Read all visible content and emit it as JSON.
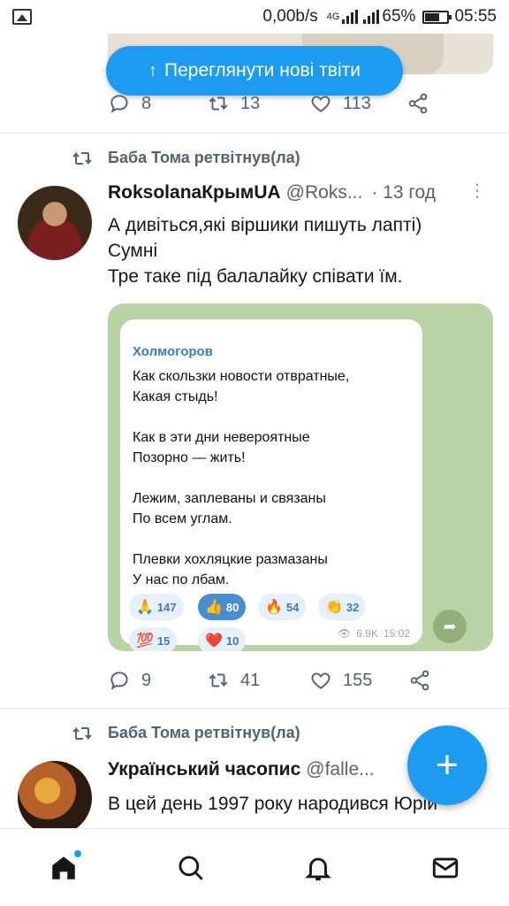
{
  "status_bar": {
    "speed": "0,00b/s",
    "network": "4G",
    "battery": "65%",
    "time": "05:55"
  },
  "banner": {
    "label": "Переглянути нові твіти"
  },
  "prev_tweet": {
    "replies": "8",
    "retweets": "13",
    "likes": "113"
  },
  "tweet1": {
    "retweeted_by": "Баба Тома ретвітнув(ла)",
    "name": "RoksolanaКрымUA",
    "handle": "@Roks...",
    "time": "· 13 год",
    "text_lines": [
      "А дивіться,які віршики пишуть лапті)",
      "Сумні",
      "Тре таке під балалайку співати їм."
    ],
    "embedded": {
      "author": "Холмогоров",
      "poem": "Как скользки новости отвратные,\nКакая стыдь!\n\nКак в эти дни невероятные\nПозорно — жить!\n\nЛежим, заплеваны и связаны\nПо всем углам.\n\nПлевки хохляцкие размазаны\nУ нас по лбам.",
      "reactions": [
        {
          "emoji": "🙏",
          "count": "147"
        },
        {
          "emoji": "👍",
          "count": "80"
        },
        {
          "emoji": "🔥",
          "count": "54"
        },
        {
          "emoji": "👏",
          "count": "32"
        },
        {
          "emoji": "💯",
          "count": "15"
        },
        {
          "emoji": "❤️",
          "count": "10"
        }
      ],
      "views": "6.9K",
      "time": "15:02"
    },
    "replies": "9",
    "retweets": "41",
    "likes": "155"
  },
  "tweet2": {
    "retweeted_by": "Баба Тома ретвітнув(ла)",
    "name": "Український часопис",
    "handle": "@falle...",
    "text_visible": "В цей день 1997 року народився Юрій"
  },
  "colors": {
    "accent": "#1d9bf0",
    "muted": "#536471"
  }
}
